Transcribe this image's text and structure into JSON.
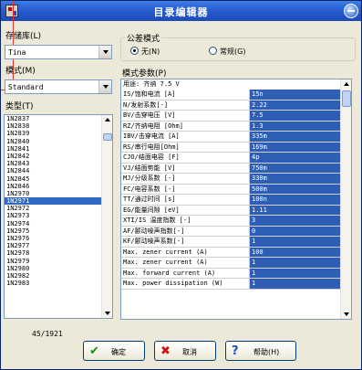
{
  "window": {
    "title": "目录编辑器",
    "title_icon": "app-icon",
    "close_icon": "minimize-icon"
  },
  "library": {
    "label": "存储库(L)",
    "value": "Tina"
  },
  "model": {
    "label": "模式(M)",
    "value": "Standard"
  },
  "type": {
    "label": "类型(T)",
    "items": [
      "1N2837",
      "1N2838",
      "1N2839",
      "1N2840",
      "1N2841",
      "1N2842",
      "1N2843",
      "1N2844",
      "1N2845",
      "1N2846",
      "1N2970",
      "1N2971",
      "1N2972",
      "1N2973",
      "1N2974",
      "1N2975",
      "1N2976",
      "1N2977",
      "1N2978",
      "1N2979",
      "1N2980",
      "1N2982",
      "1N2983"
    ],
    "selected": "1N2971"
  },
  "tolerance": {
    "title": "公差模式",
    "options": [
      "无(N)",
      "常规(G)"
    ],
    "selected": "无(N)"
  },
  "params": {
    "label": "模式参数(P)",
    "header": "用途: 齐纳 7.5 V",
    "rows": [
      {
        "name": "IS/饱和电流 [A]",
        "value": "15n"
      },
      {
        "name": "N/发射系数[-]",
        "value": "2.22"
      },
      {
        "name": "BV/击穿电压  [V]",
        "value": "7.5"
      },
      {
        "name": "RZ/齐纳电阻 [Ohm]",
        "value": "1.3"
      },
      {
        "name": "IBV/击穿电流 [A]",
        "value": "335m"
      },
      {
        "name": "RS/串行电阻[Ohm]",
        "value": "169m"
      },
      {
        "name": "CJO/结面电容        [F]",
        "value": "4p"
      },
      {
        "name": "VJ/结面势能 [V]",
        "value": "750m"
      },
      {
        "name": "MJ/分级系数     [-]",
        "value": "330m"
      },
      {
        "name": "FC/电容系数 [-]",
        "value": "500m"
      },
      {
        "name": "TT/通过时间        [s]",
        "value": "100n"
      },
      {
        "name": "EG/能量间隙          [eV]",
        "value": "1.11"
      },
      {
        "name": "XTI/IS 温度指数 [-]",
        "value": "3"
      },
      {
        "name": "AF/颤动噪声指数[-]",
        "value": "0"
      },
      {
        "name": "KF/颤动噪声系数[-]",
        "value": "1"
      },
      {
        "name": "Max. zener current (A)",
        "value": "100"
      },
      {
        "name": "Max. zener current (A)",
        "value": "1"
      },
      {
        "name": "Max. forward current (A)",
        "value": "1"
      },
      {
        "name": "Max. power dissipation (W)",
        "value": "1"
      }
    ]
  },
  "count": "45/1921",
  "buttons": {
    "ok": "确定",
    "cancel": "取消",
    "help": "帮助(H)"
  },
  "colors": {
    "selection": "#316ac5",
    "value_cell": "#2f5fb4",
    "titlebar": "#2a5fd3"
  }
}
